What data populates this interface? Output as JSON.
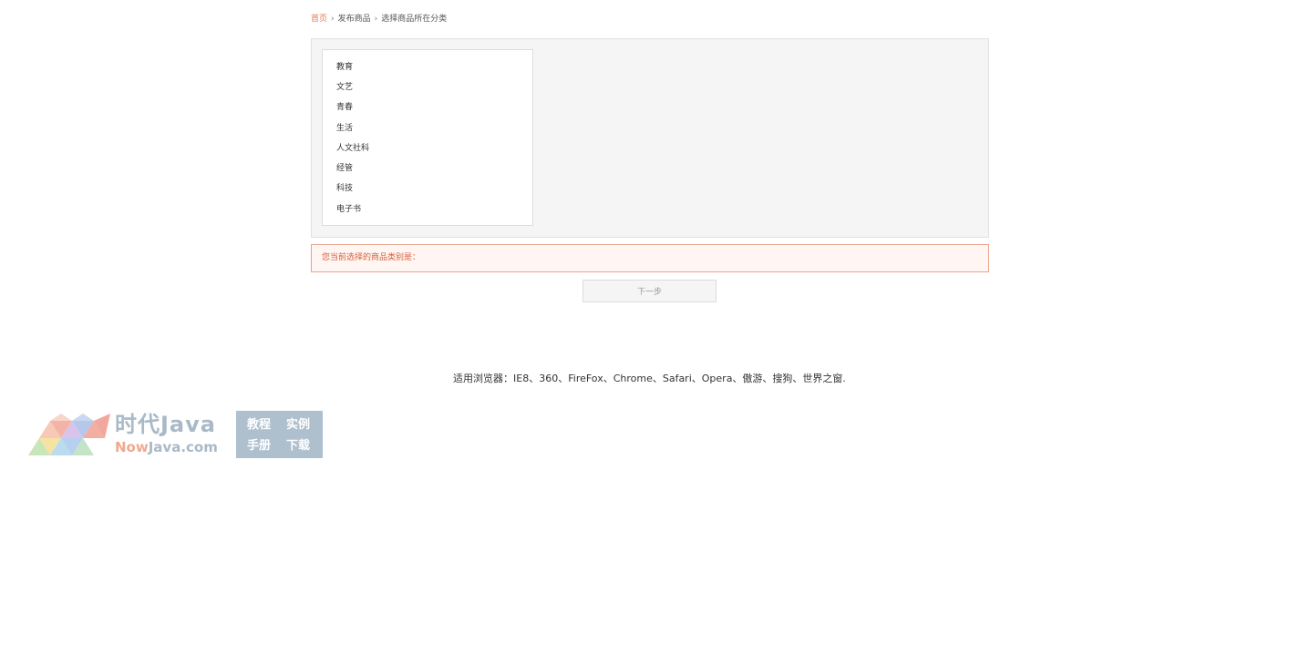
{
  "breadcrumb": {
    "home": "首页",
    "publish": "发布商品",
    "current": "选择商品所在分类",
    "separator": "›"
  },
  "categories": [
    {
      "label": "教育"
    },
    {
      "label": "文艺"
    },
    {
      "label": "青春"
    },
    {
      "label": "生活"
    },
    {
      "label": "人文社科"
    },
    {
      "label": "经管"
    },
    {
      "label": "科技"
    },
    {
      "label": "电子书"
    }
  ],
  "selection": {
    "label": "您当前选择的商品类别是："
  },
  "actions": {
    "next_label": "下一步"
  },
  "footer": {
    "browsers": "适用浏览器：IE8、360、FireFox、Chrome、Safari、Opera、傲游、搜狗、世界之窗."
  },
  "watermark": {
    "title": "时代Java",
    "domain_now": "Now",
    "domain_rest": "Java.com",
    "box_items": [
      "教程",
      "实例",
      "手册",
      "下载"
    ]
  },
  "colors": {
    "accent": "#e4784f",
    "panel_bg": "#f5f5f5",
    "selection_bg": "#fff5f2",
    "selection_border": "#e8a58c"
  }
}
